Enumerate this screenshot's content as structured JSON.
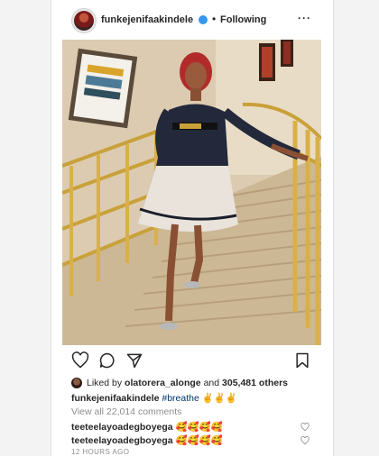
{
  "header": {
    "username": "funkejenifaakindele",
    "separator": "•",
    "follow_status": "Following",
    "more": "···"
  },
  "likes": {
    "prefix": "Liked by ",
    "user": "olatorera_alonge",
    "middle": " and ",
    "count": "305,481 others"
  },
  "caption": {
    "username": "funkejenifaakindele",
    "hashtag": "#breathe",
    "emoji": "✌✌✌"
  },
  "view_comments": "View all 22,014 comments",
  "comments": [
    {
      "username": "teeteelayoadegboyega",
      "text": "🥰🥰🥰🥰"
    },
    {
      "username": "teeteelayoadegboyega",
      "text": "🥰🥰🥰🥰"
    }
  ],
  "timestamp": "12 HOURS AGO",
  "colors": {
    "verified": "#3897f0",
    "hashtag": "#003569",
    "muted": "#8e8e8e"
  }
}
